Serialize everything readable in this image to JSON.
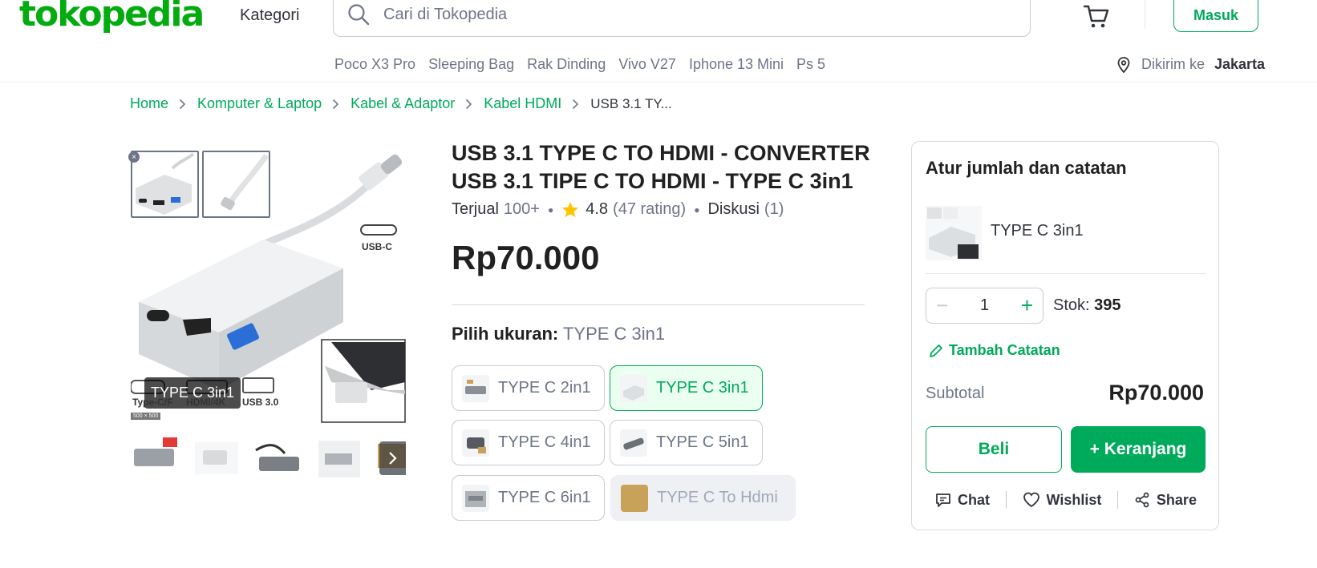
{
  "brand": {
    "logo_text": "tokopedia",
    "color": "#03ac0e"
  },
  "header": {
    "kategori": "Kategori",
    "search_placeholder": "Cari di Tokopedia",
    "login": "Masuk",
    "trending": [
      "Poco X3 Pro",
      "Sleeping Bag",
      "Rak Dinding",
      "Vivo V27",
      "Iphone 13 Mini",
      "Ps 5"
    ],
    "dikirim_label": "Dikirim ke",
    "dikirim_city": "Jakarta"
  },
  "breadcrumb": [
    "Home",
    "Komputer & Laptop",
    "Kabel & Adaptor",
    "Kabel HDMI"
  ],
  "breadcrumb_current": "USB 3.1 TY...",
  "gallery": {
    "variant_label": "TYPE C 3in1",
    "size_chip": "500 × 500",
    "port_labels": {
      "usb_c": "USB-C",
      "type_c": "Type-C/F",
      "hdmi": "HDMI/4K",
      "usb3": "USB 3.0"
    }
  },
  "product": {
    "title": "USB 3.1 TYPE C TO HDMI - CONVERTER USB 3.1 TIPE C TO HDMI - TYPE C 3in1",
    "terjual_label": "Terjual",
    "terjual_value": "100+",
    "rating": "4.8",
    "rating_count": "(47 rating)",
    "diskusi_label": "Diskusi",
    "diskusi_count": "(1)",
    "price": "Rp70.000",
    "pilih_label": "Pilih ukuran:",
    "pilih_value": "TYPE C 3in1",
    "options": [
      "TYPE C 2in1",
      "TYPE C 3in1",
      "TYPE C 4in1",
      "TYPE C 5in1",
      "TYPE C 6in1",
      "TYPE C To Hdmi"
    ]
  },
  "card": {
    "title": "Atur jumlah dan catatan",
    "variant": "TYPE C 3in1",
    "qty": "1",
    "stok_label": "Stok:",
    "stok_value": "395",
    "catatan": "Tambah Catatan",
    "subtotal_label": "Subtotal",
    "subtotal_value": "Rp70.000",
    "beli": "Beli",
    "keranjang": "+ Keranjang",
    "chat": "Chat",
    "wishlist": "Wishlist",
    "share": "Share"
  },
  "colors": {
    "primary": "#00aa5b",
    "text": "#212121",
    "muted": "#6d7588",
    "star": "#ffc400"
  }
}
